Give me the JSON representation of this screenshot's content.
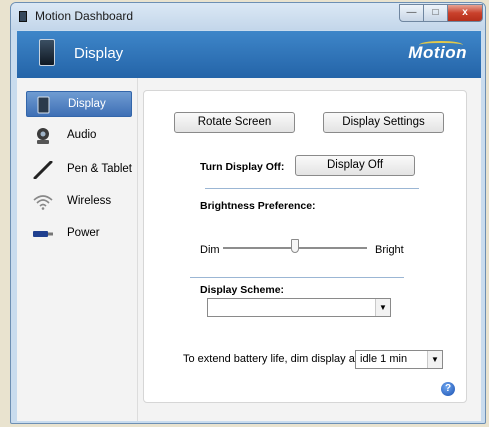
{
  "window": {
    "title": "Motion Dashboard",
    "controls": {
      "minimize": "—",
      "maximize": "□",
      "close": "x"
    }
  },
  "header": {
    "title": "Display",
    "brand": "Motion"
  },
  "sidebar": {
    "items": [
      {
        "label": "Display",
        "icon": "display-tablet-icon",
        "selected": true
      },
      {
        "label": "Audio",
        "icon": "webcam-audio-icon",
        "selected": false
      },
      {
        "label": "Pen & Tablet",
        "icon": "pen-icon",
        "selected": false
      },
      {
        "label": "Wireless",
        "icon": "wireless-signal-icon",
        "selected": false
      },
      {
        "label": "Power",
        "icon": "battery-plug-icon",
        "selected": false
      }
    ]
  },
  "panel": {
    "rotate_button": "Rotate Screen",
    "settings_button": "Display Settings",
    "turn_off_label": "Turn Display Off:",
    "turn_off_button": "Display Off",
    "brightness_label": "Brightness Preference:",
    "brightness_min_label": "Dim",
    "brightness_max_label": "Bright",
    "brightness_level": 0.5,
    "scheme_label": "Display Scheme:",
    "scheme_value": "",
    "dim_label": "To extend battery life, dim display after:",
    "dim_value": "idle 1 min",
    "help_icon": "?"
  },
  "colors": {
    "header_blue": "#2f72b8",
    "selected_nav": "#4a7cc0",
    "separator": "#9bb6d4"
  }
}
